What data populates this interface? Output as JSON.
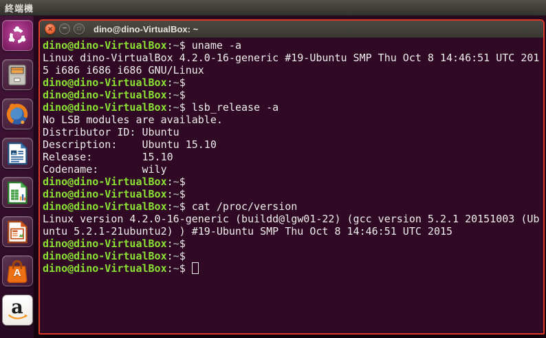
{
  "panel": {
    "title": "終端機"
  },
  "launcher": {
    "items": [
      {
        "name": "dash-home"
      },
      {
        "name": "file-manager"
      },
      {
        "name": "firefox"
      },
      {
        "name": "libreoffice-writer"
      },
      {
        "name": "libreoffice-calc"
      },
      {
        "name": "libreoffice-impress"
      },
      {
        "name": "ubuntu-software",
        "glyph": "A"
      },
      {
        "name": "amazon",
        "glyph": "a"
      }
    ]
  },
  "window": {
    "title": "dino@dino-VirtualBox: ~",
    "buttons": {
      "close": "×",
      "minimize": "−",
      "maximize": "□"
    }
  },
  "terminal": {
    "lines": [
      {
        "s": [
          [
            "g",
            "dino@dino-VirtualBox"
          ],
          [
            "w",
            ":"
          ],
          [
            "p",
            "~"
          ],
          [
            "w",
            "$ "
          ],
          [
            "w",
            "uname -a"
          ]
        ]
      },
      {
        "s": [
          [
            "w",
            "Linux dino-VirtualBox 4.2.0-16-generic #19-Ubuntu SMP Thu Oct 8 14:46:51 UTC 201"
          ]
        ]
      },
      {
        "s": [
          [
            "w",
            "5 i686 i686 i686 GNU/Linux"
          ]
        ]
      },
      {
        "s": [
          [
            "g",
            "dino@dino-VirtualBox"
          ],
          [
            "w",
            ":"
          ],
          [
            "p",
            "~"
          ],
          [
            "w",
            "$ "
          ]
        ]
      },
      {
        "s": [
          [
            "g",
            "dino@dino-VirtualBox"
          ],
          [
            "w",
            ":"
          ],
          [
            "p",
            "~"
          ],
          [
            "w",
            "$ "
          ]
        ]
      },
      {
        "s": [
          [
            "g",
            "dino@dino-VirtualBox"
          ],
          [
            "w",
            ":"
          ],
          [
            "p",
            "~"
          ],
          [
            "w",
            "$ "
          ],
          [
            "w",
            "lsb_release -a"
          ]
        ]
      },
      {
        "s": [
          [
            "w",
            "No LSB modules are available."
          ]
        ]
      },
      {
        "s": [
          [
            "w",
            "Distributor ID: Ubuntu"
          ]
        ]
      },
      {
        "s": [
          [
            "w",
            "Description:    Ubuntu 15.10"
          ]
        ]
      },
      {
        "s": [
          [
            "w",
            "Release:        15.10"
          ]
        ]
      },
      {
        "s": [
          [
            "w",
            "Codename:       wily"
          ]
        ]
      },
      {
        "s": [
          [
            "g",
            "dino@dino-VirtualBox"
          ],
          [
            "w",
            ":"
          ],
          [
            "p",
            "~"
          ],
          [
            "w",
            "$ "
          ]
        ]
      },
      {
        "s": [
          [
            "g",
            "dino@dino-VirtualBox"
          ],
          [
            "w",
            ":"
          ],
          [
            "p",
            "~"
          ],
          [
            "w",
            "$ "
          ]
        ]
      },
      {
        "s": [
          [
            "g",
            "dino@dino-VirtualBox"
          ],
          [
            "w",
            ":"
          ],
          [
            "p",
            "~"
          ],
          [
            "w",
            "$ "
          ],
          [
            "w",
            "cat /proc/version"
          ]
        ]
      },
      {
        "s": [
          [
            "w",
            "Linux version 4.2.0-16-generic (buildd@lgw01-22) (gcc version 5.2.1 20151003 (Ub"
          ]
        ]
      },
      {
        "s": [
          [
            "w",
            "untu 5.2.1-21ubuntu2) ) #19-Ubuntu SMP Thu Oct 8 14:46:51 UTC 2015"
          ]
        ]
      },
      {
        "s": [
          [
            "g",
            "dino@dino-VirtualBox"
          ],
          [
            "w",
            ":"
          ],
          [
            "p",
            "~"
          ],
          [
            "w",
            "$ "
          ]
        ]
      },
      {
        "s": [
          [
            "g",
            "dino@dino-VirtualBox"
          ],
          [
            "w",
            ":"
          ],
          [
            "p",
            "~"
          ],
          [
            "w",
            "$ "
          ]
        ]
      },
      {
        "s": [
          [
            "g",
            "dino@dino-VirtualBox"
          ],
          [
            "w",
            ":"
          ],
          [
            "p",
            "~"
          ],
          [
            "w",
            "$ "
          ]
        ],
        "cursor": true
      }
    ]
  },
  "colors": {
    "termbg": "#300A24",
    "green": "#8AE234",
    "fg": "#EEEEEC",
    "path": "#9B9B98",
    "border": "#DD3B27",
    "panel_bg": "#403E38",
    "titlebar_bg": "#403F39",
    "launcher_bg": "#371030",
    "close_button": "#EC6A3D"
  }
}
